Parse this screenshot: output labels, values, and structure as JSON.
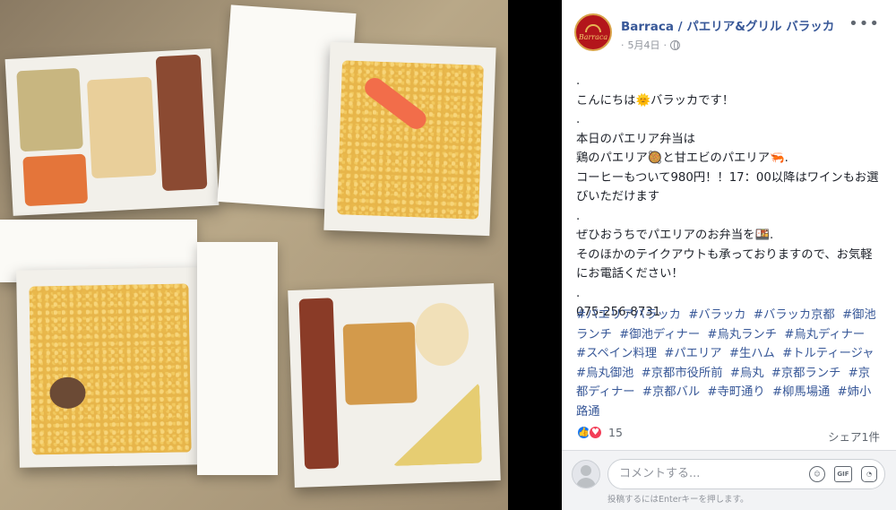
{
  "post": {
    "page_name": "Barraca / パエリア&グリル バラッカ",
    "avatar_text": "Barraca",
    "date": "5月4日",
    "date_prefix": "·",
    "more_label": "•••",
    "body": [
      ".",
      "こんにちは🌞バラッカです！",
      ".",
      "本日のパエリア弁当は",
      "鶏のパエリア🥘と甘エビのパエリア🦐.",
      "コーヒーもついて980円！！17：00以降はワインもお選びいただけます",
      ".",
      "ぜひおうちでパエリアのお弁当を🍱.",
      "そのほかのテイクアウトも承っておりますので、お気軽にお電話ください！",
      ".",
      "075-256-8731"
    ],
    "hashtags": [
      "#パエリアバラッカ",
      "#バラッカ",
      "#バラッカ京都",
      "#御池ランチ",
      "#御池ディナー",
      "#烏丸ランチ",
      "#烏丸ディナー",
      "#スペイン料理",
      "#パエリア",
      "#生ハム",
      "#トルティージャ",
      "#烏丸御池",
      "#京都市役所前",
      "#烏丸",
      "#京都ランチ",
      "#京都ディナー",
      "#京都バル",
      "#寺町通り",
      "#柳馬場通",
      "#姉小路通"
    ],
    "reaction_count": "15",
    "share_count": "シェア1件",
    "comment_placeholder": "コメントする...",
    "comment_hint": "投稿するにはEnterキーを押します。",
    "icons": {
      "emoji": "smile-icon",
      "gif": "GIF",
      "sticker": "sticker-icon"
    }
  }
}
